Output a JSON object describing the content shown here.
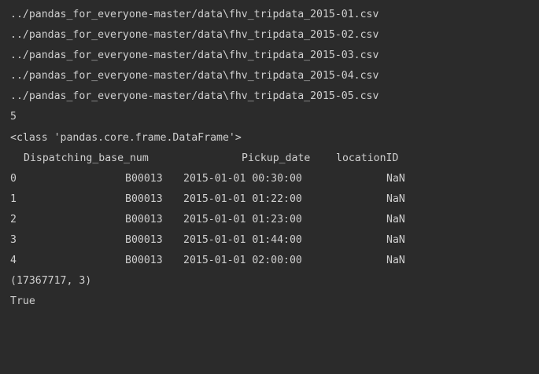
{
  "output": {
    "files": [
      "../pandas_for_everyone-master/data\\fhv_tripdata_2015-01.csv",
      "../pandas_for_everyone-master/data\\fhv_tripdata_2015-02.csv",
      "../pandas_for_everyone-master/data\\fhv_tripdata_2015-03.csv",
      "../pandas_for_everyone-master/data\\fhv_tripdata_2015-04.csv",
      "../pandas_for_everyone-master/data\\fhv_tripdata_2015-05.csv"
    ],
    "count": "5",
    "type_line": "<class 'pandas.core.frame.DataFrame'>",
    "dataframe": {
      "columns": [
        "Dispatching_base_num",
        "Pickup_date",
        "locationID"
      ],
      "rows": [
        {
          "index": "0",
          "base": "B00013",
          "date": "2015-01-01 00:30:00",
          "loc": "NaN"
        },
        {
          "index": "1",
          "base": "B00013",
          "date": "2015-01-01 01:22:00",
          "loc": "NaN"
        },
        {
          "index": "2",
          "base": "B00013",
          "date": "2015-01-01 01:23:00",
          "loc": "NaN"
        },
        {
          "index": "3",
          "base": "B00013",
          "date": "2015-01-01 01:44:00",
          "loc": "NaN"
        },
        {
          "index": "4",
          "base": "B00013",
          "date": "2015-01-01 02:00:00",
          "loc": "NaN"
        }
      ]
    },
    "shape": "(17367717, 3)",
    "result": "True"
  },
  "colors": {
    "background": "#2b2b2b",
    "text": "#cfcfcf"
  }
}
